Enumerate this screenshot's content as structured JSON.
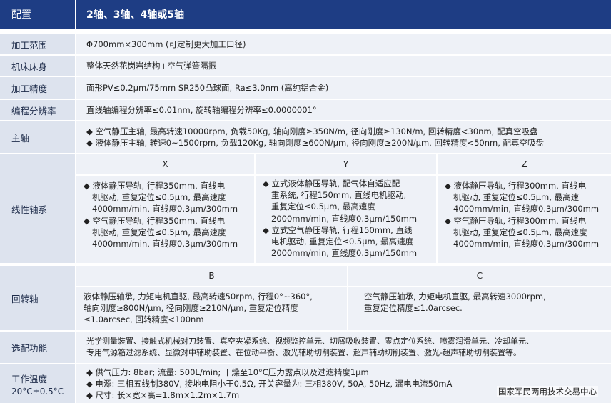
{
  "header": {
    "label": "配置",
    "value": "2轴、3轴、4轴或5轴"
  },
  "rows": {
    "range": {
      "label": "加工范围",
      "value": "Φ700mm×300mm (可定制更大加工口径)"
    },
    "bed": {
      "label": "机床床身",
      "value": "整体天然花岗岩结构+空气弹簧隔振"
    },
    "accuracy": {
      "label": "加工精度",
      "value": "面形PV≤0.2μm/75mm SR250凸球面, Ra≤3.0nm (高纯铝合金)"
    },
    "resolution": {
      "label": "编程分辨率",
      "value": "直线轴编程分辨率≤0.01nm, 旋转轴编程分辨率≤0.0000001°"
    },
    "spindle": {
      "label": "主轴",
      "lines": [
        "◆ 空气静压主轴, 最高转速10000rpm, 负载50Kg, 轴向刚度≥350N/m, 径向刚度≥130N/m, 回转精度<30nm, 配真空吸盘",
        "◆ 液体静压主轴, 转速0~1500rpm, 负载120Kg, 轴向刚度≥600N/μm, 径向刚度≥200N/μm, 回转精度<50nm, 配真空吸盘"
      ]
    },
    "linear": {
      "label": "线性轴系",
      "columns": [
        {
          "name": "X",
          "lines": [
            "◆ 液体静压导轨, 行程350mm, 直线电",
            "机驱动, 重复定位≤0.5μm, 最高速度",
            "4000mm/min, 直线度0.3μm/300mm",
            "◆ 空气静压导轨, 行程350mm, 直线电",
            "机驱动, 重复定位≤0.5μm, 最高速度",
            "4000mm/min, 直线度0.3μm/300mm"
          ]
        },
        {
          "name": "Y",
          "lines": [
            "◆ 立式液体静压导轨, 配气体自适应配",
            "重系统, 行程150mm, 直线电机驱动,",
            "重复定位≤0.5μm, 最高速度",
            "2000mm/min, 直线度0.3μm/150mm",
            "◆ 立式空气静压导轨, 行程150mm, 直线",
            "电机驱动, 重复定位≤0.5μm, 最高速度",
            "2000mm/min, 直线度0.3μm/150mm"
          ]
        },
        {
          "name": "Z",
          "lines": [
            "◆ 液体静压导轨, 行程300mm, 直线电",
            "机驱动, 重复定位≤0.5μm, 最高速",
            "4000mm/min, 直线度0.3μm/300mm",
            "◆ 空气静压导轨, 行程300mm, 直线电",
            "机驱动, 重复定位≤0.5μm, 最高速度",
            "4000mm/min, 直线度0.3μm/300mm"
          ]
        }
      ]
    },
    "rotary": {
      "label": "回转轴",
      "columns": [
        {
          "name": "B",
          "lines": [
            "液体静压轴承, 力矩电机直驱, 最高转速50rpm, 行程0°~360°,",
            "轴向刚度≥800N/μm, 径向刚度≥210N/μm, 重复定位精度",
            "≤1.0arcsec, 回转精度<100nm"
          ]
        },
        {
          "name": "C",
          "lines": [
            "空气静压轴承, 力矩电机直驱, 最高转速3000rpm,",
            "重复定位精度≤1.0arcsec."
          ]
        }
      ]
    },
    "options": {
      "label": "选配功能",
      "lines": [
        "光学测量装置、接触式机械对刀装置、真空夹紧系统、视频监控单元、切屑吸收装置、零点定位系统、喷雾润滑单元、冷却单元、",
        "专用气源箱过滤系统、显微对中辅助装置、在位动平衡、激光辅助切削装置、超声辅助切削装置、激光-超声辅助切削装置等。"
      ]
    },
    "environment": {
      "label": "工作温度",
      "label2": "20°C±0.5°C",
      "lines": [
        "◆ 供气压力: 8bar; 流量: 500L/min; 干燥至10°C压力露点以及过滤精度1μm",
        "◆ 电源: 三相五线制380V, 接地电阻小于0.5Ω, 开关容量为: 三相380V, 50A, 50Hz, 漏电电流50mA",
        "◆ 尺寸: 长×宽×高=1.8m×1.2m×1.7m"
      ]
    }
  },
  "watermark": "国家军民两用技术交易中心",
  "colors": {
    "header_bg": "#1e3d84",
    "label_bg": "#dde3ee",
    "value_bg": "#eef1f7"
  }
}
